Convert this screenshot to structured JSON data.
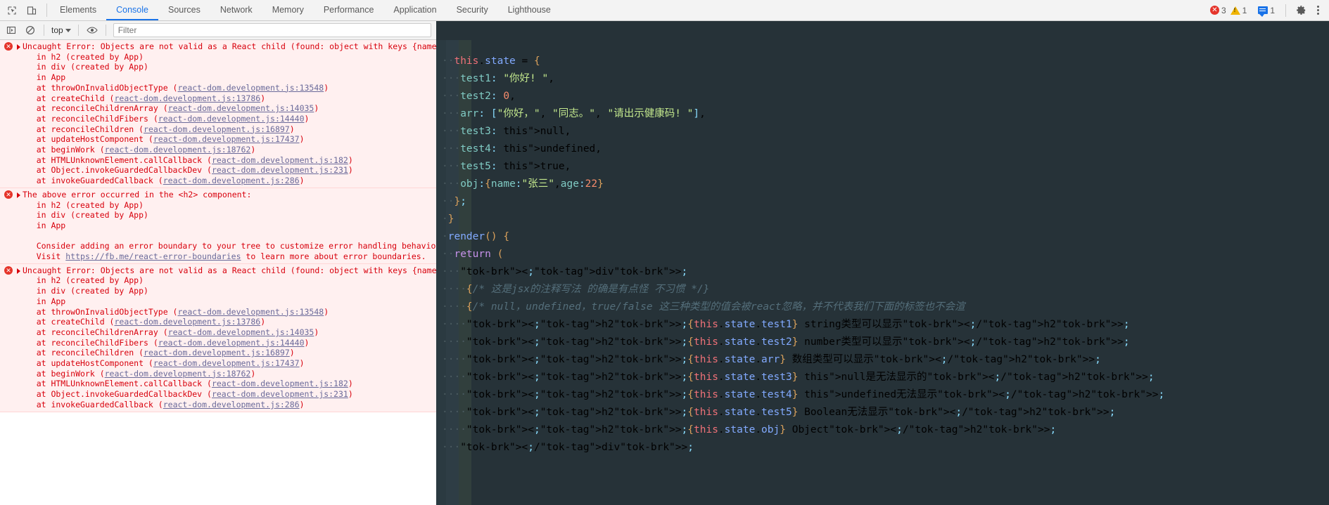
{
  "topbar": {
    "icons": [
      {
        "name": "inspect-element-icon",
        "glyph": "⬚"
      },
      {
        "name": "device-toolbar-icon",
        "glyph": "▯"
      }
    ],
    "tabs": [
      {
        "label": "Elements",
        "active": false
      },
      {
        "label": "Console",
        "active": true
      },
      {
        "label": "Sources",
        "active": false
      },
      {
        "label": "Network",
        "active": false
      },
      {
        "label": "Memory",
        "active": false
      },
      {
        "label": "Performance",
        "active": false
      },
      {
        "label": "Application",
        "active": false
      },
      {
        "label": "Security",
        "active": false
      },
      {
        "label": "Lighthouse",
        "active": false
      }
    ],
    "badges": {
      "error_count": "3",
      "warning_count": "1",
      "message_count": "1"
    },
    "settings_label": "Settings",
    "more_label": "Customize and control DevTools"
  },
  "filterbar": {
    "execute_label": "Console sidebar",
    "clear_label": "Clear console",
    "context": "top",
    "eye_label": "Live expression",
    "filter_placeholder": "Filter",
    "filter_value": ""
  },
  "console": {
    "messages": [
      {
        "level": "error",
        "expandable": true,
        "head": "Uncaught Error: Objects are not valid as a React child (found: object with keys {name",
        "lines": [
          {
            "text": "in h2 (created by App)"
          },
          {
            "text": "in div (created by App)"
          },
          {
            "text": "in App"
          },
          {
            "text": "at throwOnInvalidObjectType (",
            "link": "react-dom.development.js:13548",
            "after": ")"
          },
          {
            "text": "at createChild (",
            "link": "react-dom.development.js:13786",
            "after": ")"
          },
          {
            "text": "at reconcileChildrenArray (",
            "link": "react-dom.development.js:14035",
            "after": ")"
          },
          {
            "text": "at reconcileChildFibers (",
            "link": "react-dom.development.js:14440",
            "after": ")"
          },
          {
            "text": "at reconcileChildren (",
            "link": "react-dom.development.js:16897",
            "after": ")"
          },
          {
            "text": "at updateHostComponent (",
            "link": "react-dom.development.js:17437",
            "after": ")"
          },
          {
            "text": "at beginWork (",
            "link": "react-dom.development.js:18762",
            "after": ")"
          },
          {
            "text": "at HTMLUnknownElement.callCallback (",
            "link": "react-dom.development.js:182",
            "after": ")"
          },
          {
            "text": "at Object.invokeGuardedCallbackDev (",
            "link": "react-dom.development.js:231",
            "after": ")"
          },
          {
            "text": "at invokeGuardedCallback (",
            "link": "react-dom.development.js:286",
            "after": ")"
          }
        ]
      },
      {
        "level": "error",
        "expandable": true,
        "head": "The above error occurred in the <h2> component:",
        "lines": [
          {
            "text": "in h2 (created by App)"
          },
          {
            "text": "in div (created by App)"
          },
          {
            "text": "in App"
          },
          {
            "text": ""
          },
          {
            "text": "Consider adding an error boundary to your tree to customize error handling behavior."
          },
          {
            "text": "Visit ",
            "link": "https://fb.me/react-error-boundaries",
            "after": " to learn more about error boundaries."
          }
        ]
      },
      {
        "level": "error",
        "expandable": true,
        "head": "Uncaught Error: Objects are not valid as a React child (found: object with keys {name",
        "lines": [
          {
            "text": "in h2 (created by App)"
          },
          {
            "text": "in div (created by App)"
          },
          {
            "text": "in App"
          },
          {
            "text": "at throwOnInvalidObjectType (",
            "link": "react-dom.development.js:13548",
            "after": ")"
          },
          {
            "text": "at createChild (",
            "link": "react-dom.development.js:13786",
            "after": ")"
          },
          {
            "text": "at reconcileChildrenArray (",
            "link": "react-dom.development.js:14035",
            "after": ")"
          },
          {
            "text": "at reconcileChildFibers (",
            "link": "react-dom.development.js:14440",
            "after": ")"
          },
          {
            "text": "at reconcileChildren (",
            "link": "react-dom.development.js:16897",
            "after": ")"
          },
          {
            "text": "at updateHostComponent (",
            "link": "react-dom.development.js:17437",
            "after": ")"
          },
          {
            "text": "at beginWork (",
            "link": "react-dom.development.js:18762",
            "after": ")"
          },
          {
            "text": "at HTMLUnknownElement.callCallback (",
            "link": "react-dom.development.js:182",
            "after": ")"
          },
          {
            "text": "at Object.invokeGuardedCallbackDev (",
            "link": "react-dom.development.js:231",
            "after": ")"
          },
          {
            "text": "at invokeGuardedCallback (",
            "link": "react-dom.development.js:286",
            "after": ")"
          }
        ]
      }
    ]
  },
  "editor": {
    "lines": [
      {
        "id": "l1",
        "indent": 2,
        "raw": "this.state = {"
      },
      {
        "id": "l2",
        "indent": 3,
        "raw": "test1: \"你好! \","
      },
      {
        "id": "l3",
        "indent": 3,
        "raw": "test2: 0,"
      },
      {
        "id": "l4",
        "indent": 3,
        "raw": "arr: [\"你好，\", \"同志。\", \"请出示健康码! \"],"
      },
      {
        "id": "l5",
        "indent": 3,
        "raw": "test3: null,"
      },
      {
        "id": "l6",
        "indent": 3,
        "raw": "test4: undefined,"
      },
      {
        "id": "l7",
        "indent": 3,
        "raw": "test5: true,"
      },
      {
        "id": "l8",
        "indent": 3,
        "raw": "obj:{name:\"张三\",age:22}"
      },
      {
        "id": "l9",
        "indent": 2,
        "raw": "};"
      },
      {
        "id": "l10",
        "indent": 1,
        "raw": "}"
      },
      {
        "id": "l11",
        "indent": 1,
        "raw": "render() {"
      },
      {
        "id": "l12",
        "indent": 2,
        "raw": "return ("
      },
      {
        "id": "l13",
        "indent": 3,
        "raw": "<div>"
      },
      {
        "id": "l14",
        "indent": 4,
        "raw": "{/* 这是jsx的注释写法 的确是有点怪 不习惯 */}"
      },
      {
        "id": "l15",
        "indent": 4,
        "raw": "{/* null，undefined，true/false 这三种类型的值会被react忽略，并不代表我们下面的标签也不会渲"
      },
      {
        "id": "l16",
        "indent": 4,
        "raw": "<h2>{this.state.test1} string类型可以显示</h2>"
      },
      {
        "id": "l17",
        "indent": 4,
        "raw": "<h2>{this.state.test2} number类型可以显示</h2>"
      },
      {
        "id": "l18",
        "indent": 4,
        "raw": "<h2>{this.state.arr} 数组类型可以显示</h2>"
      },
      {
        "id": "l19",
        "indent": 4,
        "raw": "<h2>{this.state.test3} null是无法显示的</h2>"
      },
      {
        "id": "l20",
        "indent": 4,
        "raw": "<h2>{this.state.test4} undefined无法显示</h2>"
      },
      {
        "id": "l21",
        "indent": 4,
        "raw": "<h2>{this.state.test5} Boolean无法显示</h2>"
      },
      {
        "id": "l22",
        "indent": 4,
        "raw": "<h2>{this.state.obj} Object</h2>"
      },
      {
        "id": "l23",
        "indent": 3,
        "raw": "</div>"
      }
    ],
    "annotations": [
      {
        "name": "arrow-to-obj-line",
        "color": "#ee1c1c"
      },
      {
        "name": "arrow-to-object-h2-line",
        "color": "#ee1c1c"
      }
    ]
  },
  "colors": {
    "editor_bg": "#263238",
    "accent": "#1a73e8",
    "error": "#d8000c",
    "error_bg": "#fff0f0",
    "arrow": "#ee1c1c"
  }
}
